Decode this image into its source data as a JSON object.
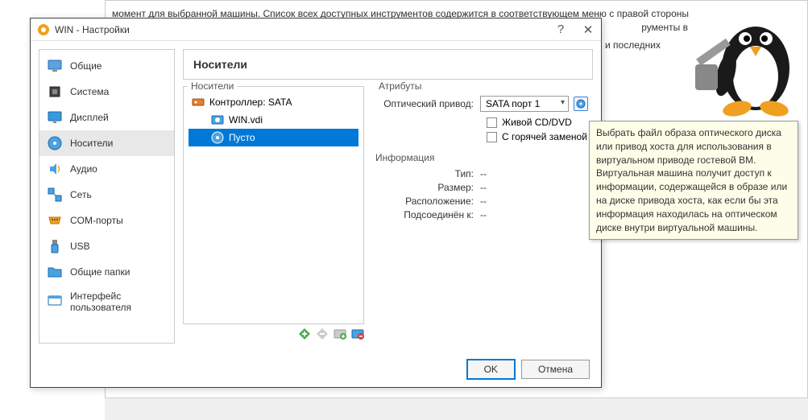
{
  "backdrop": {
    "text1": "момент для выбранной машины. Список всех доступных инструментов содержится в соответствующем меню с правой стороны",
    "text2": "рументы в",
    "text3": "и последних"
  },
  "dialog": {
    "title": "WIN - Настройки",
    "help": "?",
    "close": "✕"
  },
  "sidebar": {
    "items": [
      {
        "label": "Общие"
      },
      {
        "label": "Система"
      },
      {
        "label": "Дисплей"
      },
      {
        "label": "Носители"
      },
      {
        "label": "Аудио"
      },
      {
        "label": "Сеть"
      },
      {
        "label": "COM-порты"
      },
      {
        "label": "USB"
      },
      {
        "label": "Общие папки"
      },
      {
        "label": "Интерфейс пользователя"
      }
    ],
    "selected_index": 3
  },
  "header": {
    "title": "Носители"
  },
  "storage": {
    "panel_label": "Носители",
    "controller": "Контроллер: SATA",
    "item1": "WIN.vdi",
    "item2": "Пусто"
  },
  "attributes": {
    "panel_label": "Атрибуты",
    "drive_label": "Оптический привод:",
    "drive_value": "SATA порт 1",
    "live_cd": "Живой CD/DVD",
    "hot_swap": "С горячей заменой"
  },
  "info": {
    "section_label": "Информация",
    "type_label": "Тип:",
    "type_value": "--",
    "size_label": "Размер:",
    "size_value": "--",
    "location_label": "Расположение:",
    "location_value": "--",
    "attached_label": "Подсоединён к:",
    "attached_value": "--"
  },
  "footer": {
    "ok": "OK",
    "cancel": "Отмена"
  },
  "tooltip": {
    "text": "Выбрать файл образа оптического диска или привод хоста для использования в виртуальном приводе гостевой ВМ. Виртуальная машина получит доступ к информации, содержащейся в образе или на диске привода хоста, как если бы эта информация находилась на оптическом диске внутри виртуальной машины."
  }
}
